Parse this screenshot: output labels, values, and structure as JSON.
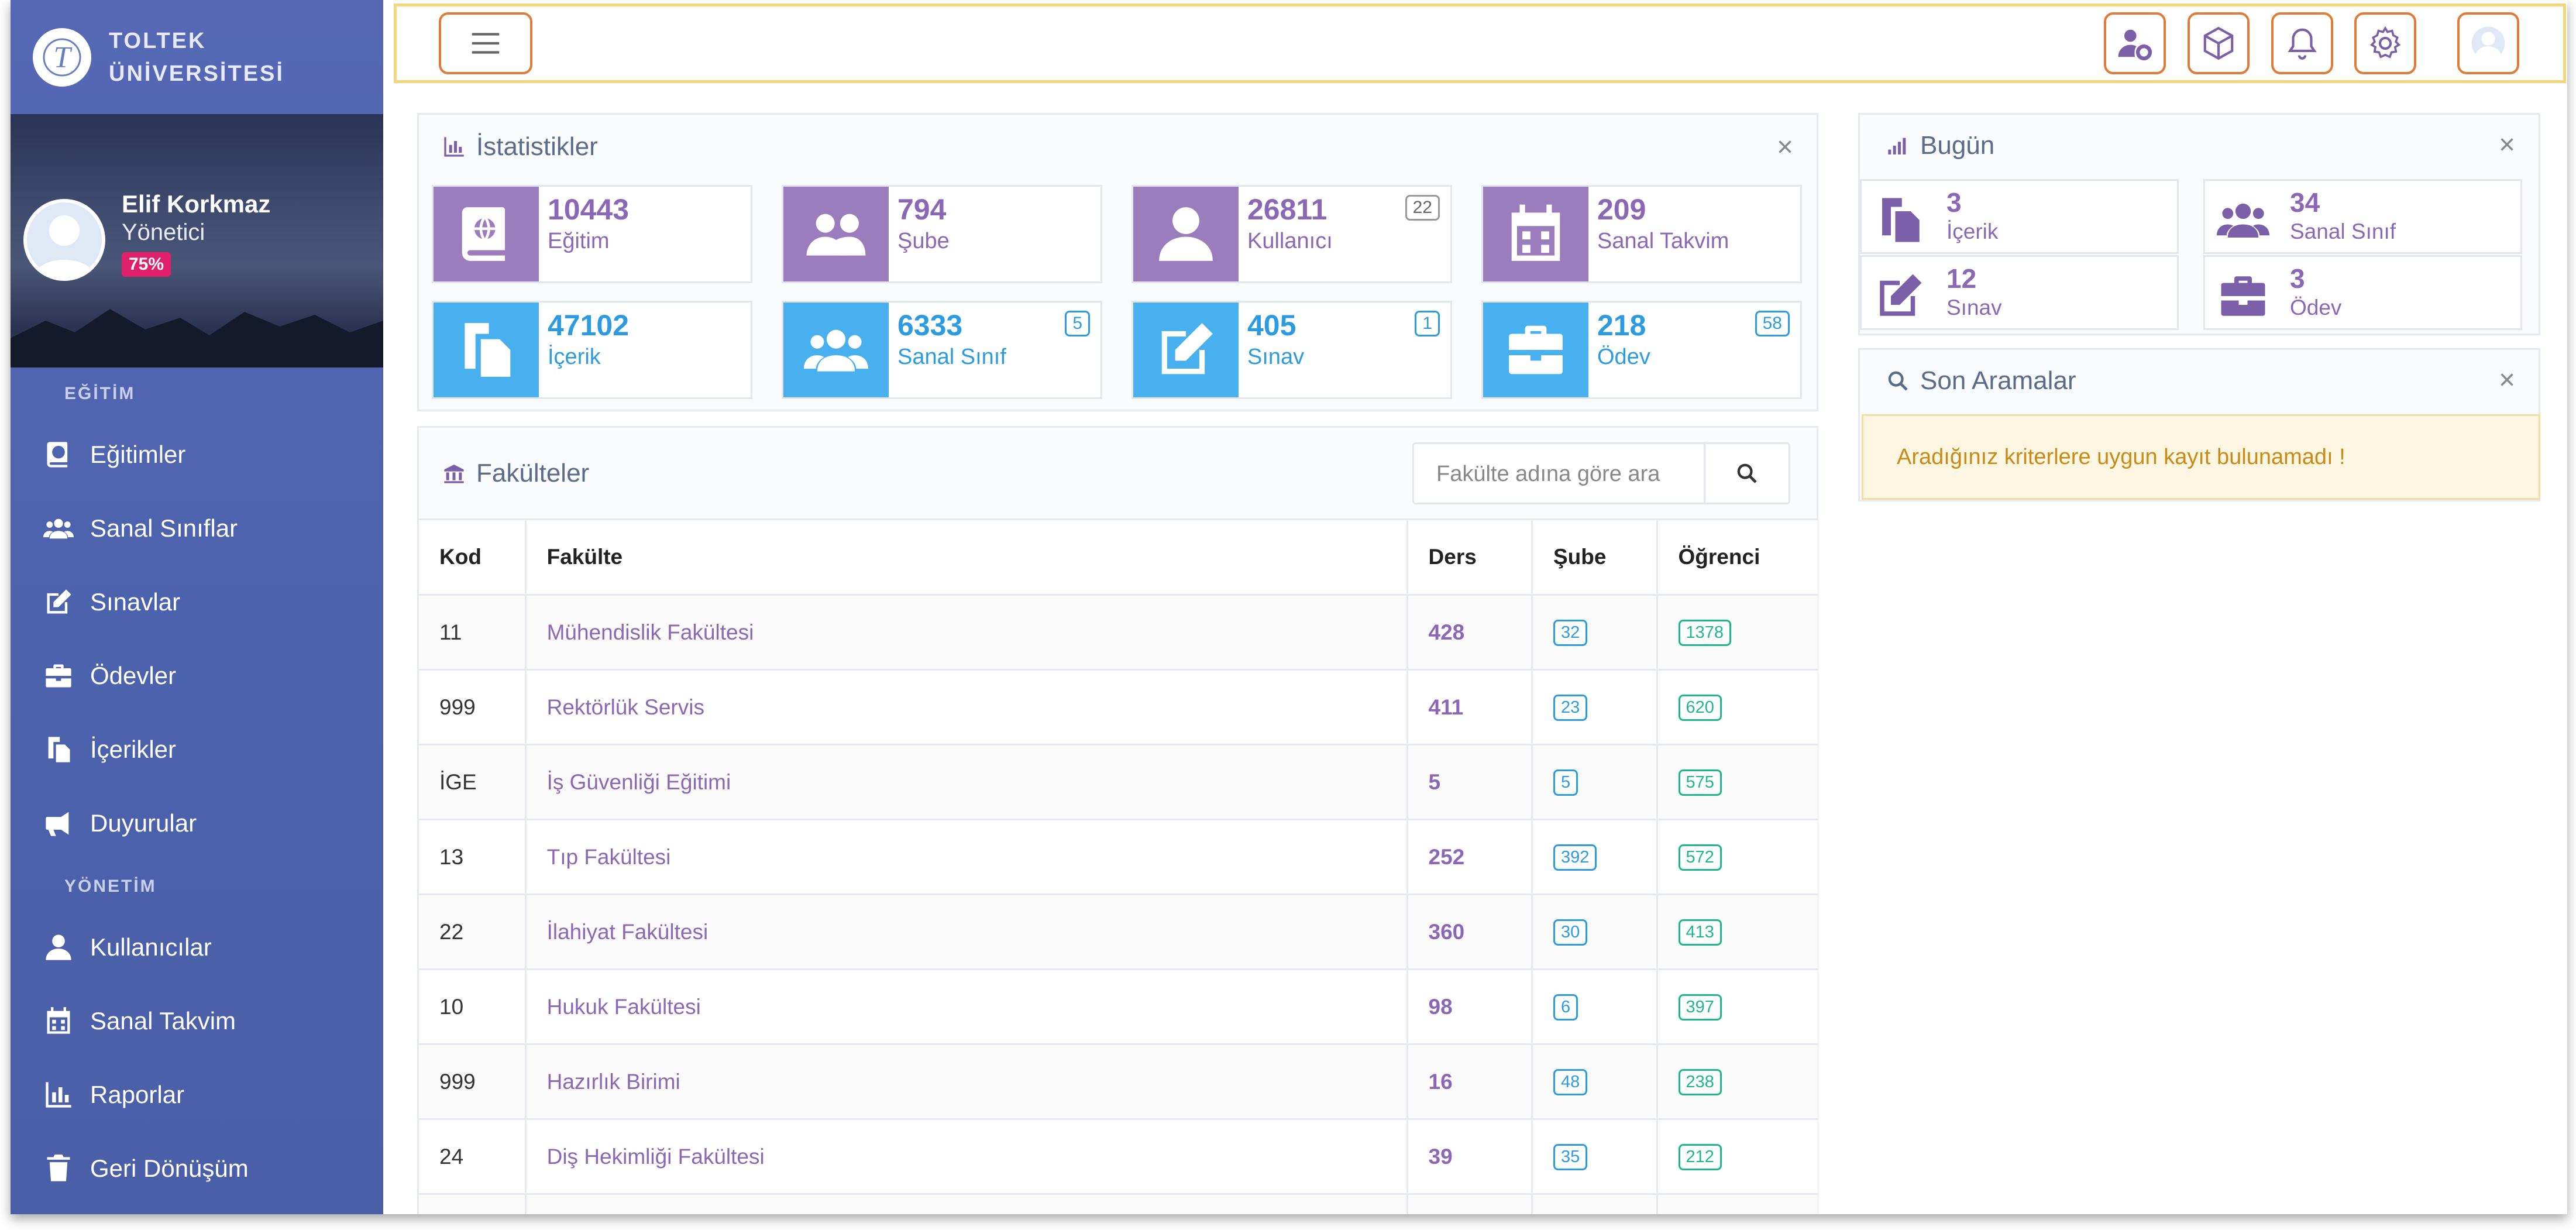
{
  "brand": {
    "line1": "TOLTEK",
    "line2": "ÜNİVERSİTESİ"
  },
  "user": {
    "name": "Elif Korkmaz",
    "role": "Yönetici",
    "progress_label": "75%"
  },
  "nav": {
    "section1": "EĞİTİM",
    "section2": "YÖNETİM",
    "items1": [
      {
        "label": "Eğitimler",
        "icon": "book-globe-icon"
      },
      {
        "label": "Sanal Sınıflar",
        "icon": "users-icon"
      },
      {
        "label": "Sınavlar",
        "icon": "edit-icon"
      },
      {
        "label": "Ödevler",
        "icon": "briefcase-icon"
      },
      {
        "label": "İçerikler",
        "icon": "copy-icon"
      },
      {
        "label": "Duyurular",
        "icon": "megaphone-icon"
      }
    ],
    "items2": [
      {
        "label": "Kullanıcılar",
        "icon": "user-icon"
      },
      {
        "label": "Sanal Takvim",
        "icon": "calendar-icon"
      },
      {
        "label": "Raporlar",
        "icon": "chart-icon"
      },
      {
        "label": "Geri Dönüşüm",
        "icon": "trash-icon"
      }
    ]
  },
  "stats_panel": {
    "title": "İstatistikler"
  },
  "stats": [
    {
      "value": "10443",
      "label": "Eğitim",
      "badge": ""
    },
    {
      "value": "794",
      "label": "Şube",
      "badge": ""
    },
    {
      "value": "26811",
      "label": "Kullanıcı",
      "badge": "22"
    },
    {
      "value": "209",
      "label": "Sanal Takvim",
      "badge": ""
    },
    {
      "value": "47102",
      "label": "İçerik",
      "badge": ""
    },
    {
      "value": "6333",
      "label": "Sanal Sınıf",
      "badge": "5"
    },
    {
      "value": "405",
      "label": "Sınav",
      "badge": "1"
    },
    {
      "value": "218",
      "label": "Ödev",
      "badge": "58"
    }
  ],
  "faculties": {
    "title": "Fakülteler",
    "search_placeholder": "Fakülte adına göre ara",
    "columns": {
      "kod": "Kod",
      "fakulte": "Fakülte",
      "ders": "Ders",
      "sube": "Şube",
      "ogrenci": "Öğrenci"
    },
    "rows": [
      {
        "kod": "11",
        "fakulte": "Mühendislik Fakültesi",
        "ders": "428",
        "sube": "32",
        "ogrenci": "1378"
      },
      {
        "kod": "999",
        "fakulte": "Rektörlük Servis",
        "ders": "411",
        "sube": "23",
        "ogrenci": "620"
      },
      {
        "kod": "İGE",
        "fakulte": "İş Güvenliği Eğitimi",
        "ders": "5",
        "sube": "5",
        "ogrenci": "575"
      },
      {
        "kod": "13",
        "fakulte": "Tıp Fakültesi",
        "ders": "252",
        "sube": "392",
        "ogrenci": "572"
      },
      {
        "kod": "22",
        "fakulte": "İlahiyat Fakültesi",
        "ders": "360",
        "sube": "30",
        "ogrenci": "413"
      },
      {
        "kod": "10",
        "fakulte": "Hukuk Fakültesi",
        "ders": "98",
        "sube": "6",
        "ogrenci": "397"
      },
      {
        "kod": "999",
        "fakulte": "Hazırlık Birimi",
        "ders": "16",
        "sube": "48",
        "ogrenci": "238"
      },
      {
        "kod": "24",
        "fakulte": "Diş Hekimliği Fakültesi",
        "ders": "39",
        "sube": "35",
        "ogrenci": "212"
      }
    ]
  },
  "today_panel": {
    "title": "Bugün",
    "items": [
      {
        "value": "3",
        "label": "İçerik"
      },
      {
        "value": "34",
        "label": "Sanal Sınıf"
      },
      {
        "value": "12",
        "label": "Sınav"
      },
      {
        "value": "3",
        "label": "Ödev"
      }
    ]
  },
  "recent_searches": {
    "title": "Son Aramalar",
    "empty_message": "Aradığınız kriterlere uygun kayıt bulunamadı !"
  },
  "colors": {
    "accent": "#8b68b6",
    "sidebar": "#4d62ad",
    "info": "#49b0f0",
    "toolbar_border": "#e07b39"
  }
}
